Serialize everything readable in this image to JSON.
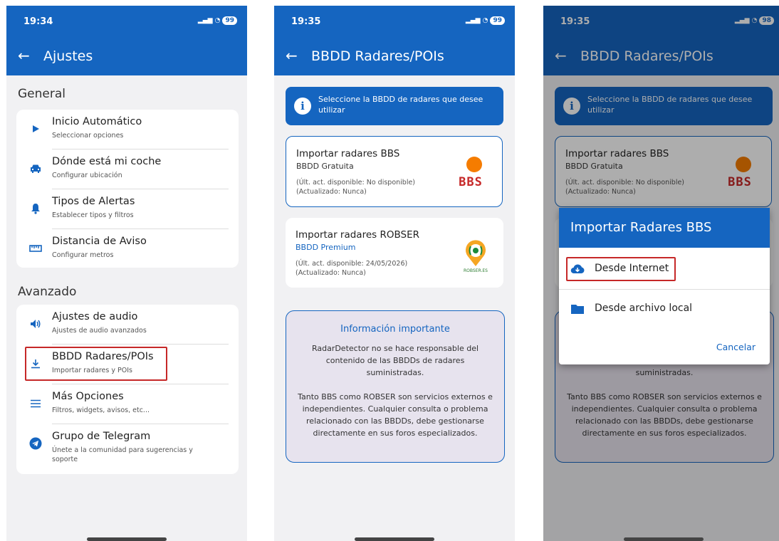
{
  "colors": {
    "primary": "#1565c0",
    "highlight": "#c62828",
    "background": "#f1f1f3"
  },
  "screen1": {
    "time": "19:34",
    "battery": "99",
    "title": "Ajustes",
    "general_label": "General",
    "general_items": [
      {
        "title": "Inicio Automático",
        "subtitle": "Seleccionar opciones",
        "icon": "play-icon"
      },
      {
        "title": "Dónde está mi coche",
        "subtitle": "Configurar ubicación",
        "icon": "car-icon"
      },
      {
        "title": "Tipos de Alertas",
        "subtitle": "Establecer tipos y filtros",
        "icon": "bell-icon"
      },
      {
        "title": "Distancia de Aviso",
        "subtitle": "Configurar metros",
        "icon": "ruler-icon"
      }
    ],
    "advanced_label": "Avanzado",
    "advanced_items": [
      {
        "title": "Ajustes de audio",
        "subtitle": "Ajustes de audio avanzados",
        "icon": "volume-icon"
      },
      {
        "title": "BBDD Radares/POIs",
        "subtitle": "Importar radares y POIs",
        "icon": "download-icon"
      },
      {
        "title": "Más Opciones",
        "subtitle": "Filtros, widgets, avisos, etc...",
        "icon": "menu-icon"
      },
      {
        "title": "Grupo de Telegram",
        "subtitle": "Únete a la comunidad para sugerencias y",
        "subtitle2": "soporte",
        "icon": "telegram-icon"
      }
    ]
  },
  "screen2": {
    "time": "19:35",
    "battery": "99",
    "title": "BBDD Radares/POIs",
    "info_text": "Seleccione la BBDD de radares que desee utilizar",
    "bbs": {
      "title": "Importar radares BBS",
      "subtitle": "BBDD Gratuita",
      "available": "(Últ. act. disponible: No disponible)",
      "updated": "(Actualizado: Nunca)",
      "logo_text": "BBS"
    },
    "robser": {
      "title": "Importar radares ROBSER",
      "subtitle": "BBDD Premium",
      "available": "(Últ. act. disponible: 24/05/2026)",
      "updated": "(Actualizado: Nunca)",
      "logo_text": "ROBSER.ES"
    },
    "important": {
      "heading": "Información importante",
      "para1": "RadarDetector no se hace responsable del contenido de las BBDDs de radares suministradas.",
      "para2": "Tanto BBS como ROBSER son servicios externos e independientes. Cualquier consulta o problema relacionado con las BBDDs, debe gestionarse directamente en sus foros especializados."
    }
  },
  "screen3": {
    "time": "19:35",
    "battery": "98",
    "dialog": {
      "title": "Importar Radares BBS",
      "option_internet": "Desde Internet",
      "option_local": "Desde archivo local",
      "cancel": "Cancelar"
    }
  },
  "status_icons": "Vo WiFi Vo WiFi"
}
